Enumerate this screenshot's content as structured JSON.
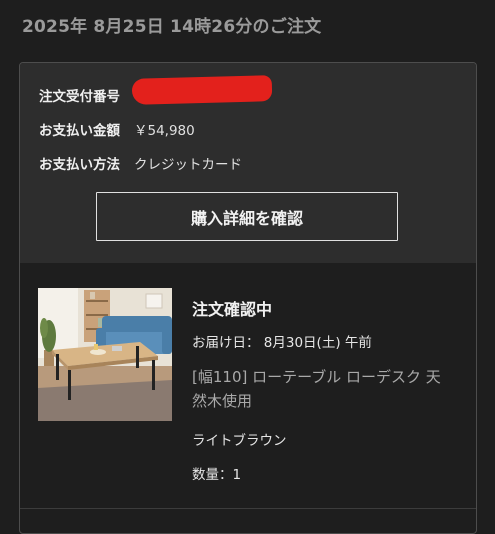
{
  "order": {
    "date_heading": "2025年 8月25日 14時26分のご注文",
    "receipt_label": "注文受付番号",
    "amount_label": "お支払い金額",
    "amount_value": "￥54,980",
    "payment_label": "お支払い方法",
    "payment_value": "クレジットカード",
    "detail_button": "購入詳細を確認"
  },
  "item": {
    "status": "注文確認中",
    "delivery": "お届け日： 8月30日(土) 午前",
    "name": "[幅110] ローテーブル ローデスク 天然木使用",
    "color": "ライトブラウン",
    "quantity": "数量：1"
  },
  "colors": {
    "background": "#1e1e1e",
    "card_top": "#2d2d2d",
    "redaction": "#e3211c"
  }
}
